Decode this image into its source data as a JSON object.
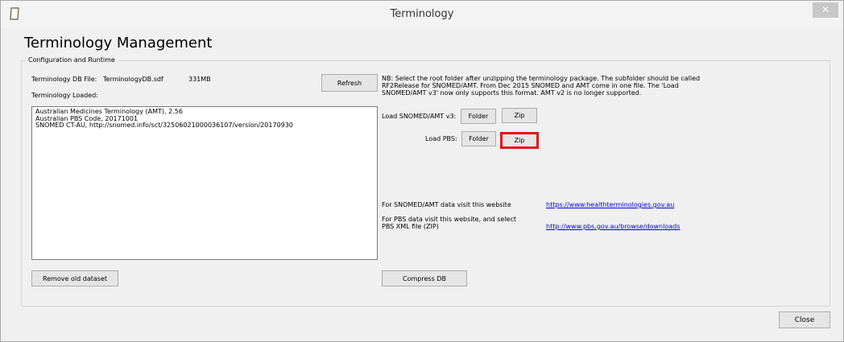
{
  "window": {
    "title": "Terminology",
    "close_glyph": "✕"
  },
  "page": {
    "heading": "Terminology Management"
  },
  "group": {
    "label": "Configuration and Runtime"
  },
  "db": {
    "file_label": "Terminology DB File:",
    "file_name": "TerminologyDB.sdf",
    "size": "331MB",
    "loaded_label": "Terminology Loaded:",
    "refresh_label": "Refresh"
  },
  "loaded_items": [
    "Australian Medicines Terminology (AMT), 2.56",
    "Australian PBS Code, 20171001",
    "SNOMED CT-AU, http://snomed.info/sct/32506021000036107/version/20170930"
  ],
  "notes": {
    "line1": "NB: Select the root folder after unzipping the terminology package.  The subfolder should be called",
    "line2": "RF2Release for SNOMED/AMT. From Dec 2015 SNOMED and AMT come in one file. The 'Load",
    "line3": "SNOMED/AMT v3' now only supports this format. AMT v2 is no longer supported."
  },
  "snomed": {
    "label": "Load SNOMED/AMT v3:",
    "folder_label": "Folder",
    "zip_label": "Zip"
  },
  "pbs": {
    "label": "Load PBS:",
    "folder_label": "Folder",
    "zip_label": "Zip"
  },
  "links": {
    "snomed_text": "For SNOMED/AMT data visit this website",
    "snomed_url": "https://www.healthterminologies.gov.au",
    "pbs_text_1": "For PBS data visit this website, and select",
    "pbs_text_2": "PBS XML file (ZIP)",
    "pbs_url": "http://www.pbs.gov.au/browse/downloads"
  },
  "actions": {
    "remove_label": "Remove old dataset",
    "compress_label": "Compress DB",
    "close_label": "Close"
  }
}
